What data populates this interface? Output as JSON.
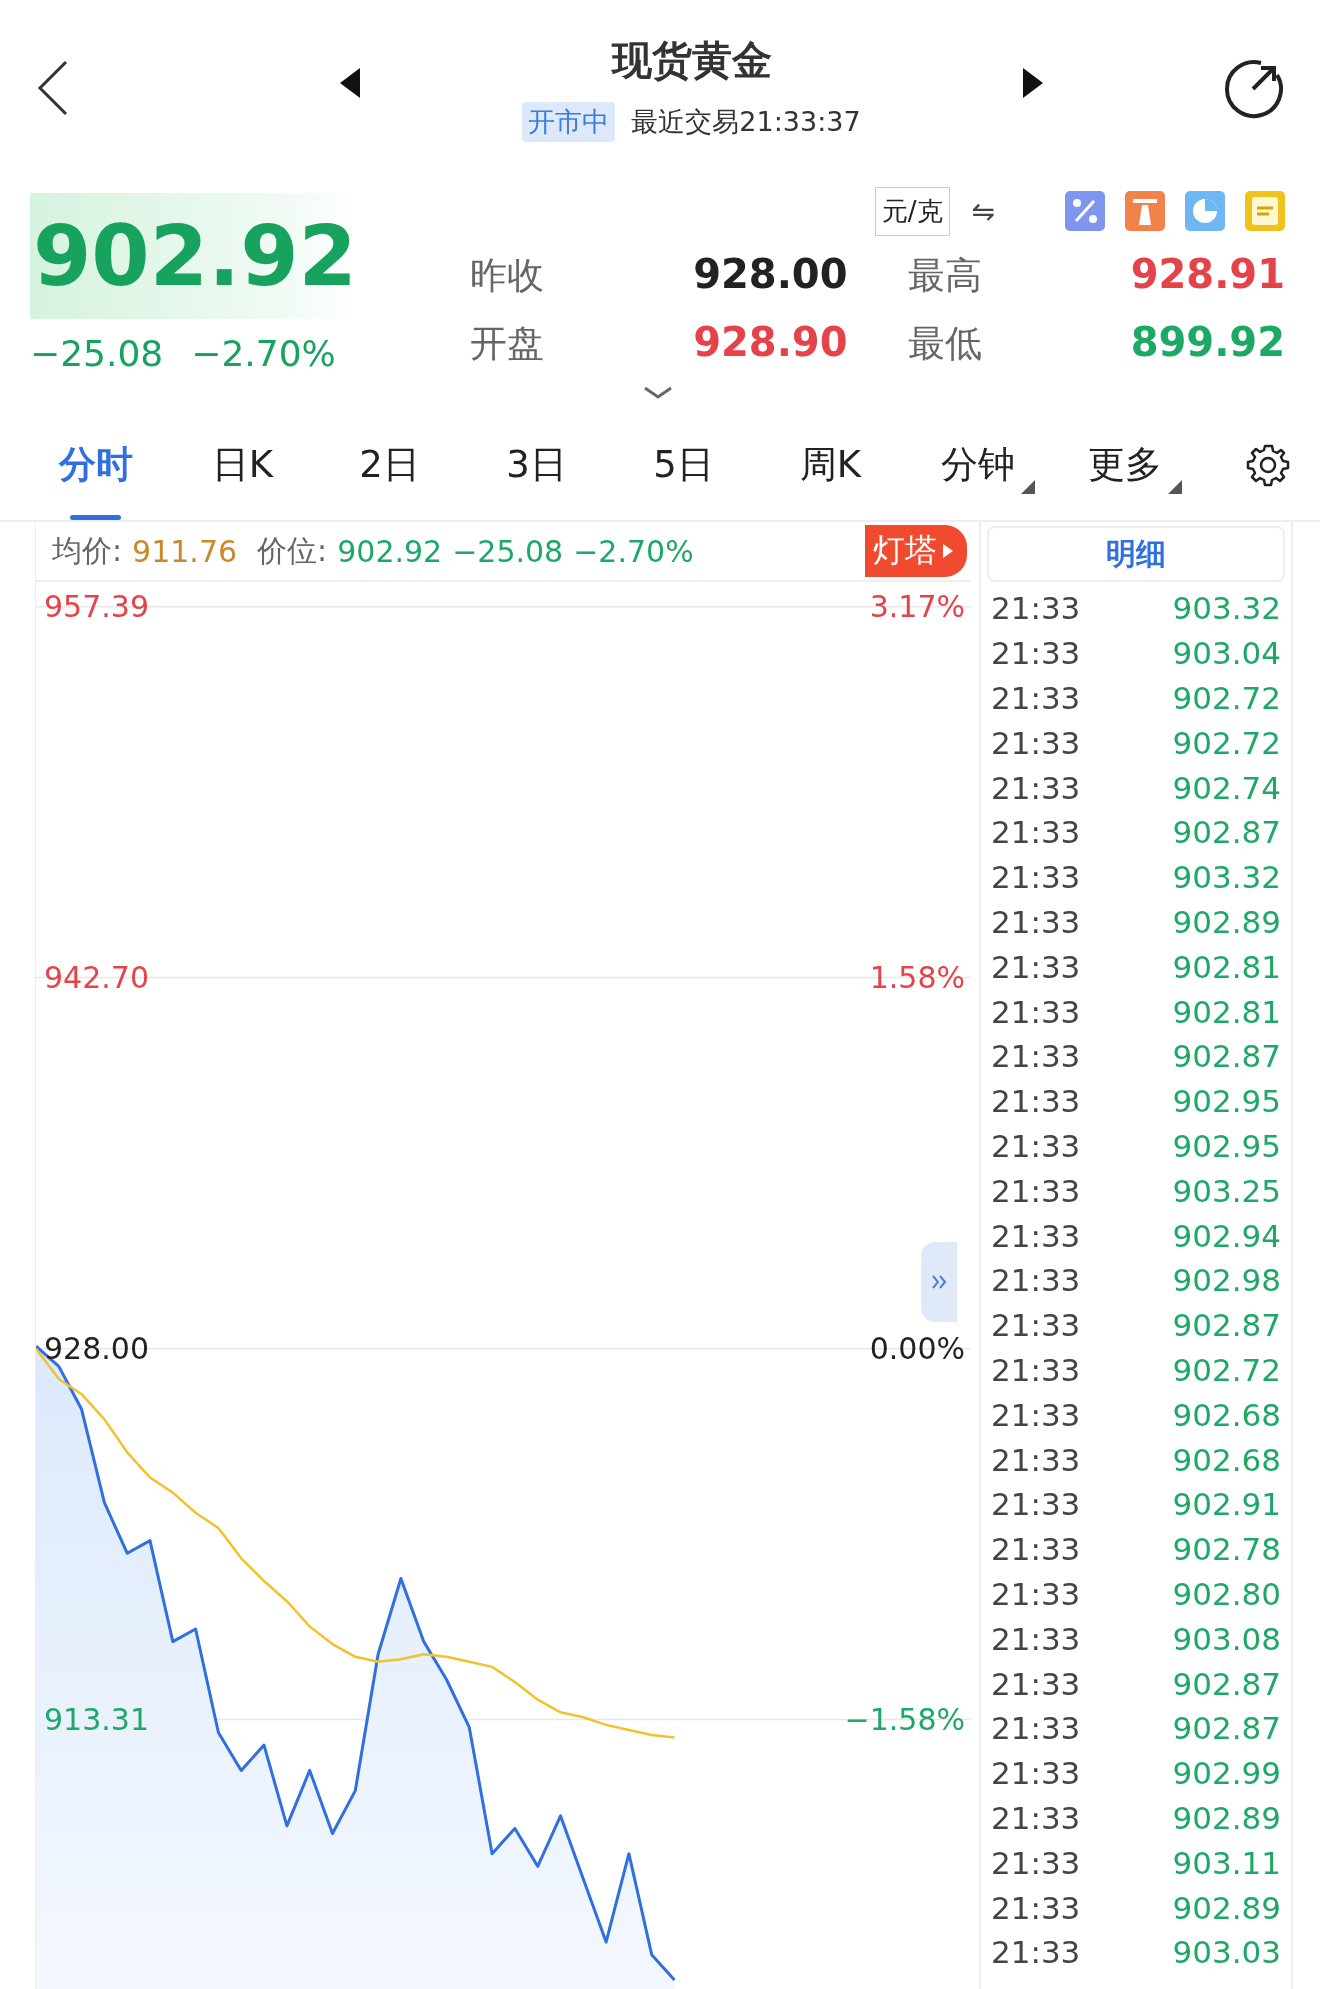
{
  "header": {
    "title": "现货黄金",
    "status_badge": "开市中",
    "last_trade": "最近交易21:33:37"
  },
  "quote": {
    "price": "902.92",
    "color": "#17a35e",
    "change": "−25.08",
    "change_percent": "−2.70%",
    "unit": "元/克",
    "swap_symbol": "⇋",
    "stats": [
      {
        "label": "昨收",
        "value": "928.00",
        "color": "#222222"
      },
      {
        "label": "最高",
        "value": "928.91",
        "color": "#e5434a"
      },
      {
        "label": "开盘",
        "value": "928.90",
        "color": "#e5434a"
      },
      {
        "label": "最低",
        "value": "899.92",
        "color": "#1ea866"
      }
    ]
  },
  "tabs": [
    {
      "label": "分时",
      "selected": true,
      "has_menu": false
    },
    {
      "label": "日K",
      "selected": false,
      "has_menu": false
    },
    {
      "label": "2日",
      "selected": false,
      "has_menu": false
    },
    {
      "label": "3日",
      "selected": false,
      "has_menu": false
    },
    {
      "label": "5日",
      "selected": false,
      "has_menu": false
    },
    {
      "label": "周K",
      "selected": false,
      "has_menu": false
    },
    {
      "label": "分钟",
      "selected": false,
      "has_menu": true
    },
    {
      "label": "更多",
      "selected": false,
      "has_menu": true
    }
  ],
  "chart_panel": {
    "avg_value": "911.76",
    "price_value": "902.92",
    "change": "−25.08",
    "change_percent": "−2.70%",
    "badge": "灯塔",
    "percent_labels": [
      {
        "text": "3.17%",
        "color": "#e5434a"
      },
      {
        "text": "1.58%",
        "color": "#e5434a"
      },
      {
        "text": "0.00%",
        "color": "#222222"
      },
      {
        "text": "−1.58%",
        "color": "#1ea866"
      }
    ],
    "chart_data": {
      "type": "line",
      "categories": [
        null,
        null,
        null,
        null,
        null,
        null,
        null,
        null,
        null,
        null,
        null,
        null,
        null,
        null,
        null,
        null,
        null,
        null,
        null,
        null,
        null,
        null,
        null,
        null,
        null,
        null,
        null,
        null,
        null,
        null,
        null,
        null,
        null,
        null,
        null,
        null,
        null,
        null,
        null,
        null,
        null,
        null
      ],
      "series": [
        {
          "name": "价位:",
          "color": "#2f6fe0",
          "values": [
            928.1,
            927.3,
            925.6,
            921.9,
            919.9,
            920.4,
            916.4,
            916.9,
            912.8,
            911.3,
            912.3,
            909.1,
            911.3,
            908.8,
            910.5,
            915.9,
            918.9,
            916.4,
            914.9,
            913.0,
            908.0,
            909.0,
            907.5,
            909.5,
            907.0,
            904.5,
            908.0,
            904.0,
            903.0,
            null,
            null,
            null,
            null,
            null,
            null,
            null,
            null,
            null,
            null,
            null,
            null,
            null
          ]
        },
        {
          "name": "均价:",
          "color": "#f2c12e",
          "values": [
            928.0,
            926.8,
            926.2,
            925.2,
            923.9,
            922.9,
            922.3,
            921.5,
            920.9,
            919.7,
            918.8,
            918.0,
            917.0,
            916.3,
            915.8,
            915.6,
            915.7,
            915.9,
            915.8,
            915.6,
            915.4,
            914.8,
            914.1,
            913.6,
            913.4,
            913.1,
            912.9,
            912.7,
            912.6,
            null,
            null,
            null,
            null,
            null,
            null,
            null,
            null,
            null,
            null,
            null,
            null,
            null
          ]
        }
      ],
      "ylim": [
        902.64,
        958.37
      ],
      "grid": true,
      "yticks": [
        {
          "value": 957.39,
          "label": "957.39"
        },
        {
          "value": 942.7,
          "label": "942.70"
        },
        {
          "value": 928.0,
          "label": "928.00"
        },
        {
          "value": 913.31,
          "label": "913.31"
        }
      ]
    }
  },
  "detail": {
    "title": "明细",
    "trades": [
      {
        "time": "21:33",
        "price": "903.32"
      },
      {
        "time": "21:33",
        "price": "903.04"
      },
      {
        "time": "21:33",
        "price": "902.72"
      },
      {
        "time": "21:33",
        "price": "902.72"
      },
      {
        "time": "21:33",
        "price": "902.74"
      },
      {
        "time": "21:33",
        "price": "902.87"
      },
      {
        "time": "21:33",
        "price": "903.32"
      },
      {
        "time": "21:33",
        "price": "902.89"
      },
      {
        "time": "21:33",
        "price": "902.81"
      },
      {
        "time": "21:33",
        "price": "902.81"
      },
      {
        "time": "21:33",
        "price": "902.87"
      },
      {
        "time": "21:33",
        "price": "902.95"
      },
      {
        "time": "21:33",
        "price": "902.95"
      },
      {
        "time": "21:33",
        "price": "903.25"
      },
      {
        "time": "21:33",
        "price": "902.94"
      },
      {
        "time": "21:33",
        "price": "902.98"
      },
      {
        "time": "21:33",
        "price": "902.87"
      },
      {
        "time": "21:33",
        "price": "902.72"
      },
      {
        "time": "21:33",
        "price": "902.68"
      },
      {
        "time": "21:33",
        "price": "902.68"
      },
      {
        "time": "21:33",
        "price": "902.91"
      },
      {
        "time": "21:33",
        "price": "902.78"
      },
      {
        "time": "21:33",
        "price": "902.80"
      },
      {
        "time": "21:33",
        "price": "903.08"
      },
      {
        "time": "21:33",
        "price": "902.87"
      },
      {
        "time": "21:33",
        "price": "902.87"
      },
      {
        "time": "21:33",
        "price": "902.99"
      },
      {
        "time": "21:33",
        "price": "902.89"
      },
      {
        "time": "21:33",
        "price": "903.11"
      },
      {
        "time": "21:33",
        "price": "902.89"
      },
      {
        "time": "21:33",
        "price": "903.03"
      }
    ]
  }
}
